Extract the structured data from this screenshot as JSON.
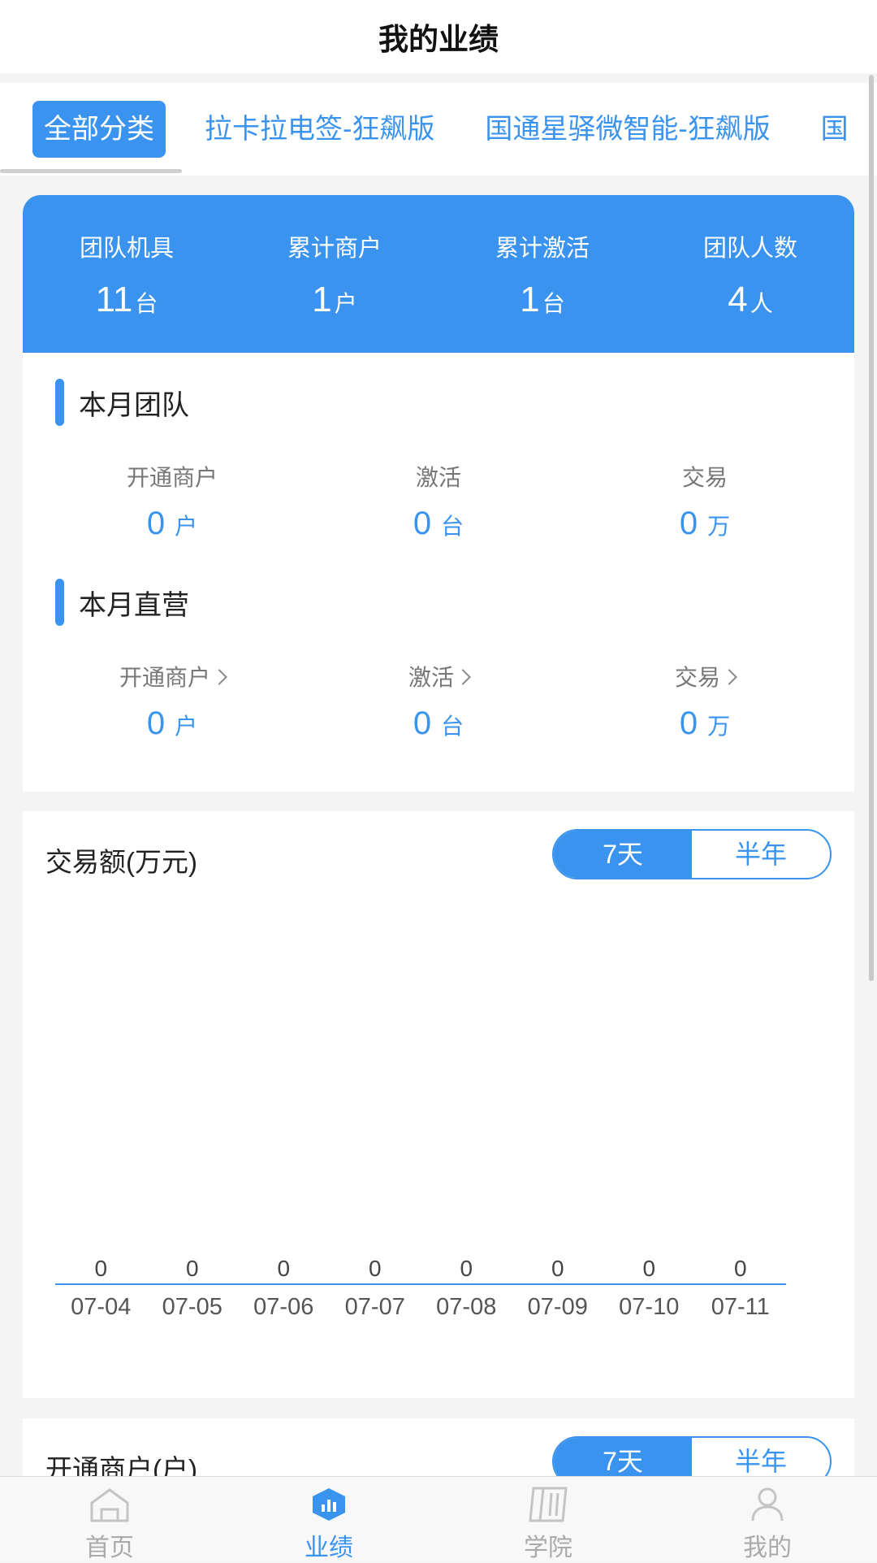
{
  "header": {
    "title": "我的业绩"
  },
  "tabs": [
    {
      "label": "全部分类",
      "active": true
    },
    {
      "label": "拉卡拉电签-狂飙版",
      "active": false
    },
    {
      "label": "国通星驿微智能-狂飙版",
      "active": false
    },
    {
      "label": "国",
      "active": false
    }
  ],
  "stats": [
    {
      "label": "团队机具",
      "value": "11",
      "unit": "台"
    },
    {
      "label": "累计商户",
      "value": "1",
      "unit": "户"
    },
    {
      "label": "累计激活",
      "value": "1",
      "unit": "台"
    },
    {
      "label": "团队人数",
      "value": "4",
      "unit": "人"
    }
  ],
  "team_month": {
    "title": "本月团队",
    "metrics": [
      {
        "label": "开通商户",
        "value": "0",
        "unit": "户"
      },
      {
        "label": "激活",
        "value": "0",
        "unit": "台"
      },
      {
        "label": "交易",
        "value": "0",
        "unit": "万"
      }
    ]
  },
  "direct_month": {
    "title": "本月直营",
    "metrics": [
      {
        "label": "开通商户",
        "value": "0",
        "unit": "户"
      },
      {
        "label": "激活",
        "value": "0",
        "unit": "台"
      },
      {
        "label": "交易",
        "value": "0",
        "unit": "万"
      }
    ]
  },
  "transaction_chart": {
    "title": "交易额(万元)",
    "toggle": {
      "option_7d": "7天",
      "option_half_year": "半年",
      "selected": "7天"
    }
  },
  "chart_data": {
    "type": "bar",
    "categories": [
      "07-04",
      "07-05",
      "07-06",
      "07-07",
      "07-08",
      "07-09",
      "07-10",
      "07-11"
    ],
    "values": [
      0,
      0,
      0,
      0,
      0,
      0,
      0,
      0
    ],
    "title": "交易额(万元)",
    "data_labels": true,
    "grid": false
  },
  "merchant_chart": {
    "title": "开通商户(户)",
    "toggle": {
      "option_7d": "7天",
      "option_half_year": "半年",
      "selected": "7天"
    }
  },
  "bottom_nav": [
    {
      "label": "首页",
      "icon": "home-icon",
      "active": false
    },
    {
      "label": "业绩",
      "icon": "performance-icon",
      "active": true
    },
    {
      "label": "学院",
      "icon": "academy-icon",
      "active": false
    },
    {
      "label": "我的",
      "icon": "profile-icon",
      "active": false
    }
  ],
  "colors": {
    "accent": "#3a93ee",
    "background": "#f4f4f4"
  }
}
